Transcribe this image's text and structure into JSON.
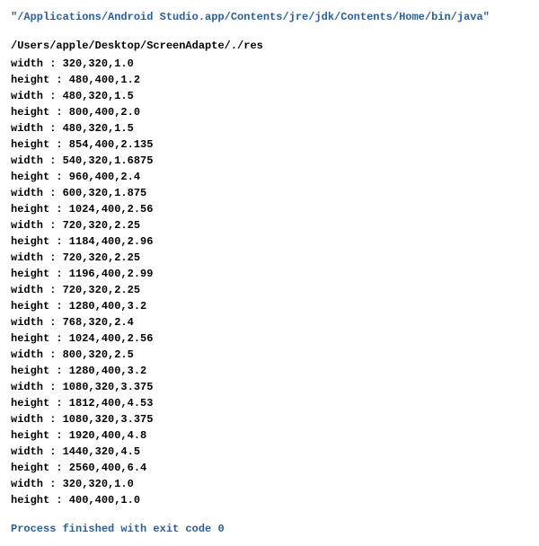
{
  "header": "\"/Applications/Android Studio.app/Contents/jre/jdk/Contents/Home/bin/java\"",
  "path": "/Users/apple/Desktop/ScreenAdapte/./res",
  "lines": [
    "width : 320,320,1.0",
    "height : 480,400,1.2",
    "width : 480,320,1.5",
    "height : 800,400,2.0",
    "width : 480,320,1.5",
    "height : 854,400,2.135",
    "width : 540,320,1.6875",
    "height : 960,400,2.4",
    "width : 600,320,1.875",
    "height : 1024,400,2.56",
    "width : 720,320,2.25",
    "height : 1184,400,2.96",
    "width : 720,320,2.25",
    "height : 1196,400,2.99",
    "width : 720,320,2.25",
    "height : 1280,400,3.2",
    "width : 768,320,2.4",
    "height : 1024,400,2.56",
    "width : 800,320,2.5",
    "height : 1280,400,3.2",
    "width : 1080,320,3.375",
    "height : 1812,400,4.53",
    "width : 1080,320,3.375",
    "height : 1920,400,4.8",
    "width : 1440,320,4.5",
    "height : 2560,400,6.4",
    "width : 320,320,1.0",
    "height : 400,400,1.0"
  ],
  "footer": "Process finished with exit code 0"
}
